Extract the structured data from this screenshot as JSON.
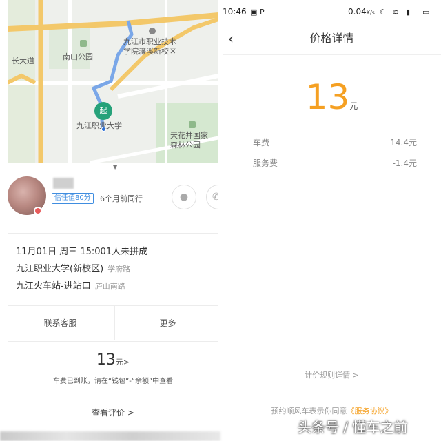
{
  "map": {
    "labels": {
      "park": "南山公园",
      "college": "九江市职业技术学院濂溪新校区",
      "university": "九江职业大学",
      "forest": "天花井国家森林公园",
      "road": "长大道"
    },
    "start_pin": "起",
    "route_color": "#7aa7e8",
    "road_color": "#f3c86a",
    "pin_color": "#26a27a"
  },
  "driver": {
    "credit_badge": "信任值80分",
    "history": "6个月前同行",
    "chat_icon": "chat-bubble-icon",
    "phone_icon": "phone-icon"
  },
  "trip": {
    "datetime": "11月01日 周三 15:00",
    "status": "1人未拼成",
    "from_name": "九江职业大学(新校区)",
    "from_road": "学府路",
    "to_name": "九江火车站-进站口",
    "to_road": "庐山南路"
  },
  "actions": {
    "contact": "联系客服",
    "more": "更多"
  },
  "fare": {
    "amount": "13",
    "unit": "元",
    "chevron": ">",
    "note": "车费已到账，请在“钱包”-“余额”中查看"
  },
  "evaluation": {
    "label": "查看评价",
    "chevron": ">"
  },
  "statusbar": {
    "time": "10:46",
    "net_speed": "0.04",
    "net_unit": "K/s"
  },
  "price_detail": {
    "title": "价格详情",
    "total": "13",
    "unit": "元",
    "rows": [
      {
        "label": "车费",
        "value": "14.4元"
      },
      {
        "label": "服务费",
        "value": "-1.4元"
      }
    ],
    "rules_link": "计价规则详情 >",
    "agreement_text": "预约顺风车表示你同意",
    "agreement_link": "《服务协议》",
    "accent": "#f5a022"
  },
  "watermark": "头条号 / 懂车之前"
}
